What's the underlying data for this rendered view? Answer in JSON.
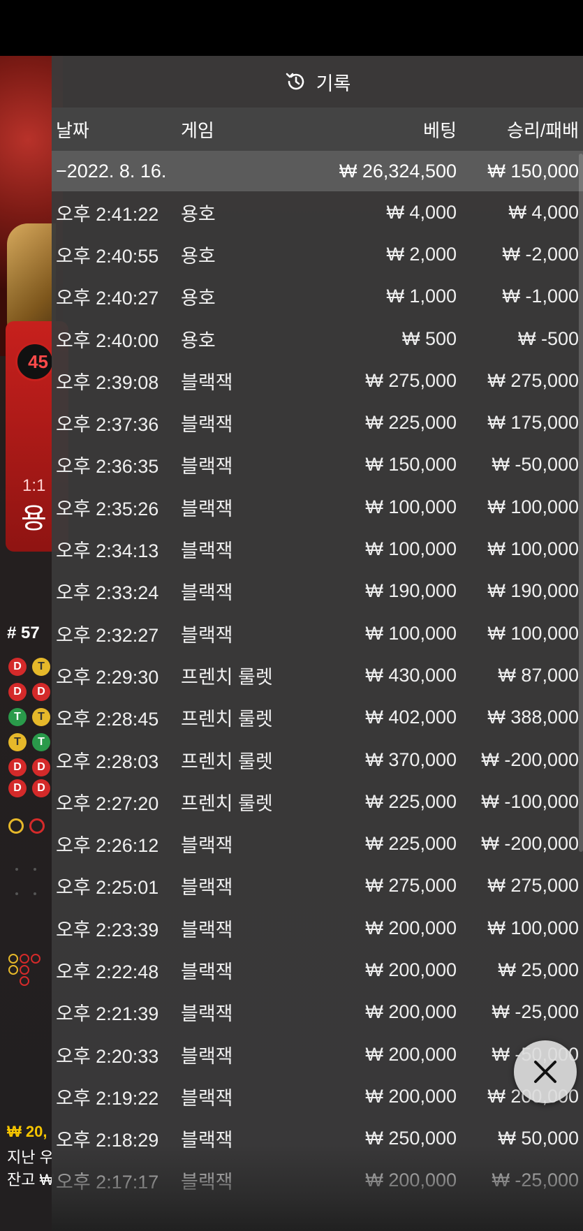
{
  "panel": {
    "title": "기록",
    "columns": {
      "date": "날짜",
      "game": "게임",
      "bet": "베팅",
      "result": "승리/패배"
    },
    "day": {
      "label": "−2022. 8. 16.",
      "bet_total": "₩ 26,324,500",
      "result_total": "₩ 150,000"
    },
    "rows": [
      {
        "time": "오후 2:41:22",
        "game": "용호",
        "bet": "₩ 4,000",
        "result": "₩ 4,000"
      },
      {
        "time": "오후 2:40:55",
        "game": "용호",
        "bet": "₩ 2,000",
        "result": "₩ -2,000"
      },
      {
        "time": "오후 2:40:27",
        "game": "용호",
        "bet": "₩ 1,000",
        "result": "₩ -1,000"
      },
      {
        "time": "오후 2:40:00",
        "game": "용호",
        "bet": "₩ 500",
        "result": "₩ -500"
      },
      {
        "time": "오후 2:39:08",
        "game": "블랙잭",
        "bet": "₩ 275,000",
        "result": "₩ 275,000"
      },
      {
        "time": "오후 2:37:36",
        "game": "블랙잭",
        "bet": "₩ 225,000",
        "result": "₩ 175,000"
      },
      {
        "time": "오후 2:36:35",
        "game": "블랙잭",
        "bet": "₩ 150,000",
        "result": "₩ -50,000"
      },
      {
        "time": "오후 2:35:26",
        "game": "블랙잭",
        "bet": "₩ 100,000",
        "result": "₩ 100,000"
      },
      {
        "time": "오후 2:34:13",
        "game": "블랙잭",
        "bet": "₩ 100,000",
        "result": "₩ 100,000"
      },
      {
        "time": "오후 2:33:24",
        "game": "블랙잭",
        "bet": "₩ 190,000",
        "result": "₩ 190,000"
      },
      {
        "time": "오후 2:32:27",
        "game": "블랙잭",
        "bet": "₩ 100,000",
        "result": "₩ 100,000"
      },
      {
        "time": "오후 2:29:30",
        "game": "프렌치 룰렛",
        "bet": "₩ 430,000",
        "result": "₩ 87,000"
      },
      {
        "time": "오후 2:28:45",
        "game": "프렌치 룰렛",
        "bet": "₩ 402,000",
        "result": "₩ 388,000"
      },
      {
        "time": "오후 2:28:03",
        "game": "프렌치 룰렛",
        "bet": "₩ 370,000",
        "result": "₩ -200,000"
      },
      {
        "time": "오후 2:27:20",
        "game": "프렌치 룰렛",
        "bet": "₩ 225,000",
        "result": "₩ -100,000"
      },
      {
        "time": "오후 2:26:12",
        "game": "블랙잭",
        "bet": "₩ 225,000",
        "result": "₩ -200,000"
      },
      {
        "time": "오후 2:25:01",
        "game": "블랙잭",
        "bet": "₩ 275,000",
        "result": "₩ 275,000"
      },
      {
        "time": "오후 2:23:39",
        "game": "블랙잭",
        "bet": "₩ 200,000",
        "result": "₩ 100,000"
      },
      {
        "time": "오후 2:22:48",
        "game": "블랙잭",
        "bet": "₩ 200,000",
        "result": "₩ 25,000"
      },
      {
        "time": "오후 2:21:39",
        "game": "블랙잭",
        "bet": "₩ 200,000",
        "result": "₩ -25,000"
      },
      {
        "time": "오후 2:20:33",
        "game": "블랙잭",
        "bet": "₩ 200,000",
        "result": "₩ -50,000"
      },
      {
        "time": "오후 2:19:22",
        "game": "블랙잭",
        "bet": "₩ 200,000",
        "result": "₩ 200,000"
      },
      {
        "time": "오후 2:18:29",
        "game": "블랙잭",
        "bet": "₩ 250,000",
        "result": "₩ 50,000"
      },
      {
        "time": "오후 2:17:17",
        "game": "블랙잭",
        "bet": "₩ 200,000",
        "result": "₩ -25,000"
      }
    ]
  },
  "background": {
    "badge": "45",
    "ratio": "1:1",
    "dragon": "용",
    "round": "# 57",
    "balance": "₩ 20,",
    "last_label": "지난 우",
    "balance_label": "잔고 ₩"
  },
  "icons": {
    "history": "history-icon",
    "close": "close-icon"
  },
  "colors": {
    "panel_bg": "#3a3a3a",
    "day_row_bg": "#5b5b5b",
    "bead_dragon": "#d42a2a",
    "bead_tie": "#e6b82a",
    "bead_tiger_green": "#2a9a4a"
  }
}
